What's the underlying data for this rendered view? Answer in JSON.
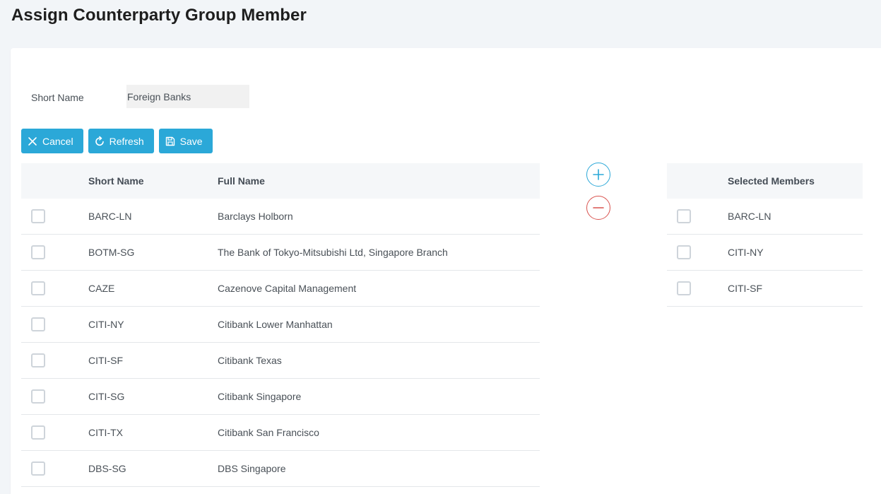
{
  "page": {
    "title": "Assign Counterparty Group Member"
  },
  "form": {
    "short_name_label": "Short Name",
    "short_name_value": "Foreign Banks"
  },
  "toolbar": {
    "cancel_label": "Cancel",
    "refresh_label": "Refresh",
    "save_label": "Save"
  },
  "available": {
    "columns": {
      "short_name": "Short Name",
      "full_name": "Full Name"
    },
    "rows": [
      {
        "short": "BARC-LN",
        "full": "Barclays Holborn"
      },
      {
        "short": "BOTM-SG",
        "full": "The Bank of Tokyo-Mitsubishi Ltd, Singapore Branch"
      },
      {
        "short": "CAZE",
        "full": "Cazenove Capital Management"
      },
      {
        "short": "CITI-NY",
        "full": "Citibank Lower Manhattan"
      },
      {
        "short": "CITI-SF",
        "full": "Citibank Texas"
      },
      {
        "short": "CITI-SG",
        "full": "Citibank Singapore"
      },
      {
        "short": "CITI-TX",
        "full": "Citibank San Francisco"
      },
      {
        "short": "DBS-SG",
        "full": "DBS Singapore"
      }
    ]
  },
  "selected": {
    "column": "Selected Members",
    "rows": [
      {
        "short": "BARC-LN"
      },
      {
        "short": "CITI-NY"
      },
      {
        "short": "CITI-SF"
      }
    ]
  },
  "icons": {
    "cancel": "close-icon",
    "refresh": "refresh-icon",
    "save": "save-icon",
    "add": "plus-circle-icon",
    "remove": "minus-circle-icon"
  },
  "colors": {
    "accent": "#2ba8d8",
    "danger": "#d9534f",
    "page_bg": "#f2f5f8"
  }
}
